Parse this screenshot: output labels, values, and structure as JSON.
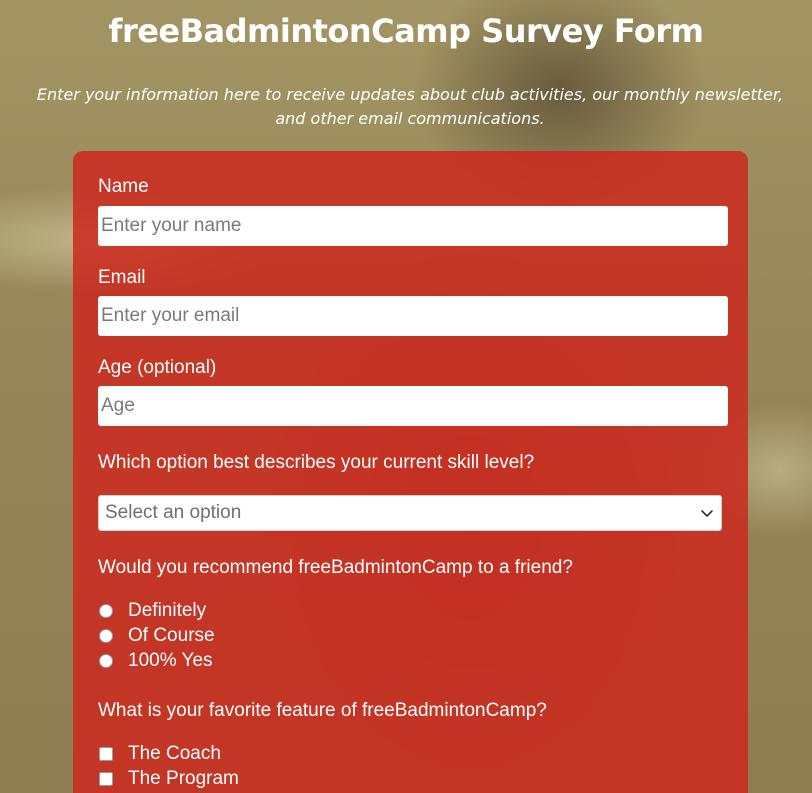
{
  "header": {
    "title": "freeBadmintonCamp Survey Form",
    "description_line1": "Enter your information here to receive updates about club activities, our monthly newsletter,",
    "description_line2": "and other email communications."
  },
  "form": {
    "name_label": "Name",
    "name_placeholder": "Enter your name",
    "email_label": "Email",
    "email_placeholder": "Enter your email",
    "age_label": "Age (optional)",
    "age_placeholder": "Age",
    "skill_question": "Which option best describes your current skill level?",
    "skill_select_value": "Select an option",
    "recommend_question": "Would you recommend freeBadmintonCamp to a friend?",
    "recommend_options": [
      "Definitely",
      "Of Course",
      "100% Yes"
    ],
    "feature_question": "What is your favorite feature of freeBadmintonCamp?",
    "feature_options": [
      "The Coach",
      "The Program"
    ]
  },
  "colors": {
    "form_background": "#cc2a1e",
    "page_background": "#9a8a5c",
    "text": "#ffffff"
  },
  "icons": {
    "select_arrow": "chevron-down-icon"
  }
}
